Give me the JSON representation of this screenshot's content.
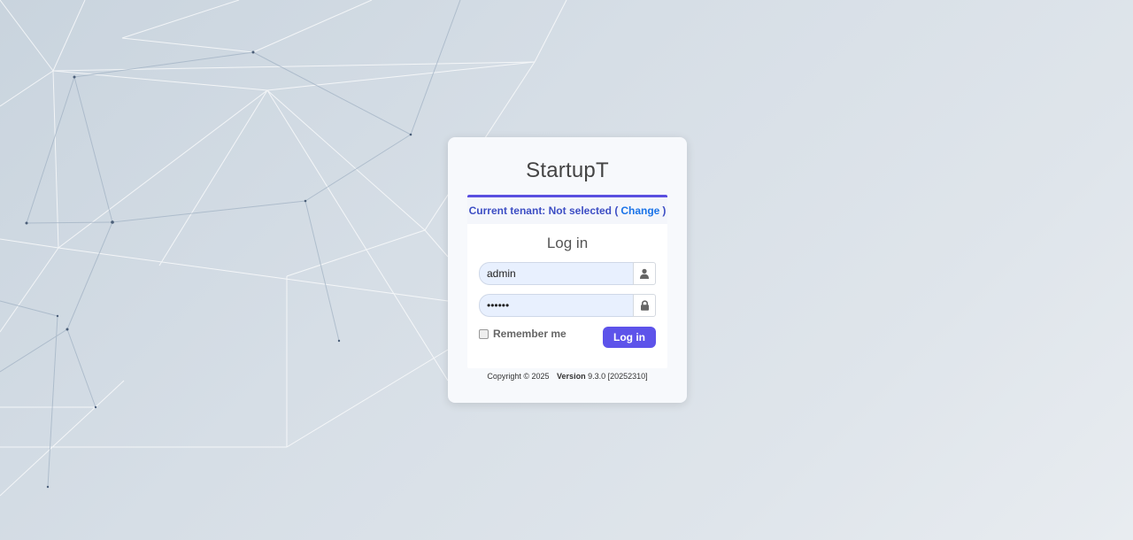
{
  "app": {
    "title": "StartupT"
  },
  "tenant": {
    "prefix": "Current tenant: Not selected (",
    "change_label": "Change",
    "suffix": ")"
  },
  "login": {
    "heading": "Log in",
    "username_value": "admin",
    "password_value": "••••••",
    "remember_label": "Remember me",
    "remember_checked": false,
    "button_label": "Log in"
  },
  "footer": {
    "copyright": "Copyright © 2025",
    "version_label": "Version",
    "version_value": "9.3.0 [20252310]"
  },
  "icons": {
    "username": "user-icon",
    "password": "lock-icon"
  },
  "colors": {
    "accent": "#5d53ea",
    "tenant_text": "#3d4ec4",
    "change_link": "#1a73e8"
  }
}
